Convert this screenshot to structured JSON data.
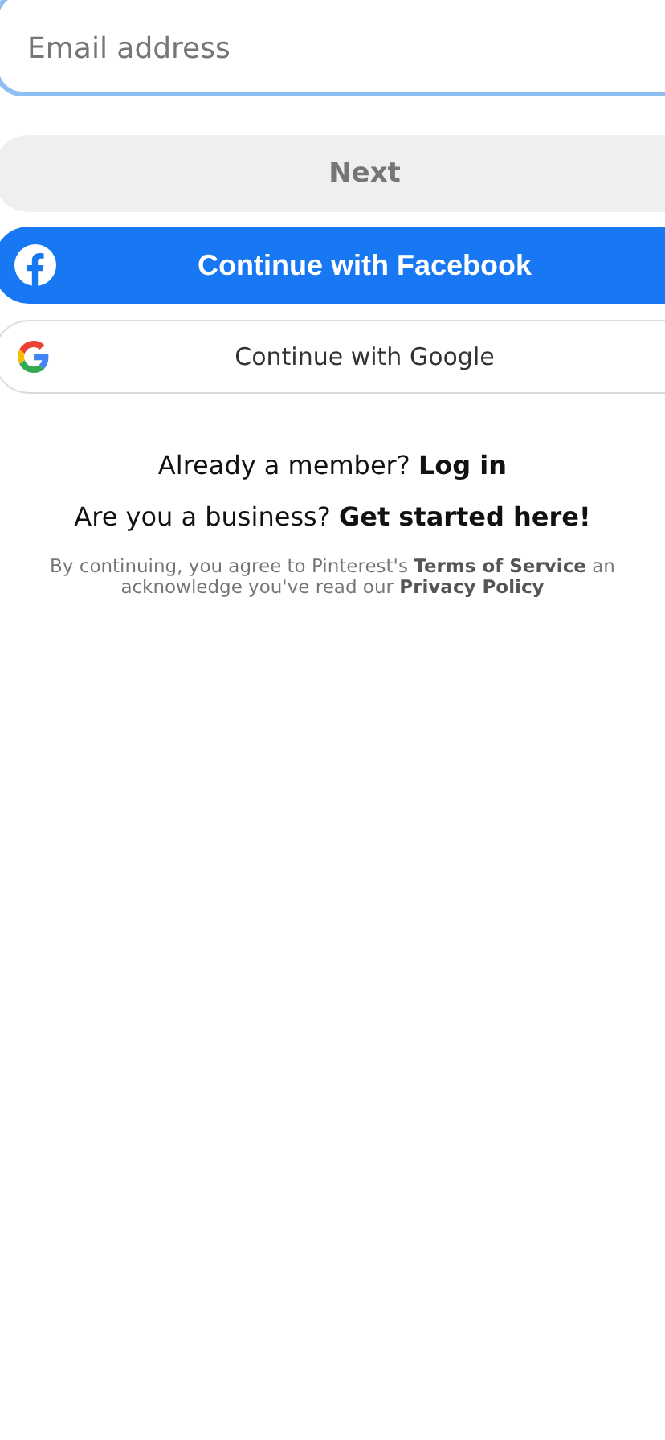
{
  "email_field": {
    "placeholder": "Email address",
    "focused": true
  },
  "next_button": {
    "label": "Next",
    "disabled": true
  },
  "facebook_button": {
    "label": "Continue with Facebook"
  },
  "google_button": {
    "label": "Continue with Google"
  },
  "login_prompt": "Already a member? **Log in**",
  "business_prompt": "Are you a business? **Get started here!**",
  "terms_text": "By continuing, you agree to Pinterest's **Terms of Service** an\nacknowledge you've read our **Privacy Policy**"
}
